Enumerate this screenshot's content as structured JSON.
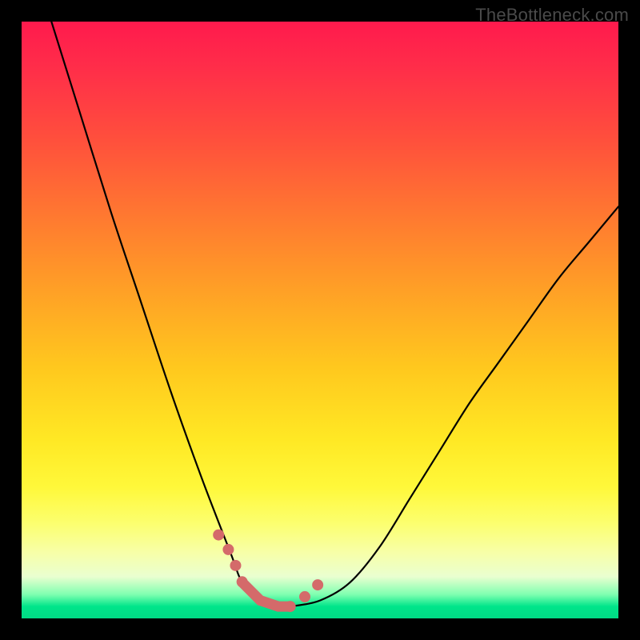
{
  "attribution": "TheBottleneck.com",
  "chart_data": {
    "type": "line",
    "title": "",
    "xlabel": "",
    "ylabel": "",
    "xlim": [
      0,
      100
    ],
    "ylim": [
      0,
      100
    ],
    "grid": false,
    "legend": false,
    "background_gradient": {
      "direction": "vertical",
      "stops": [
        {
          "pos": 0.0,
          "color": "#ff1a4d"
        },
        {
          "pos": 0.5,
          "color": "#ffc81e"
        },
        {
          "pos": 0.8,
          "color": "#fff83a"
        },
        {
          "pos": 0.95,
          "color": "#7fffb0"
        },
        {
          "pos": 1.0,
          "color": "#00db85"
        }
      ]
    },
    "series": [
      {
        "name": "bottleneck-curve",
        "x": [
          5,
          10,
          15,
          20,
          25,
          30,
          35,
          37,
          40,
          43,
          45,
          50,
          55,
          60,
          65,
          70,
          75,
          80,
          85,
          90,
          95,
          100
        ],
        "y": [
          100,
          84,
          68,
          53,
          38,
          24,
          11,
          6,
          3,
          2,
          2,
          3,
          6,
          12,
          20,
          28,
          36,
          43,
          50,
          57,
          63,
          69
        ]
      }
    ],
    "highlight_region": {
      "name": "optimal-window",
      "x": [
        33,
        35,
        37,
        40,
        43,
        45,
        48,
        50
      ],
      "y": [
        14,
        11,
        6,
        3,
        2,
        2,
        4,
        6
      ],
      "color": "#d46a6a",
      "style": "dotted-thick"
    }
  }
}
